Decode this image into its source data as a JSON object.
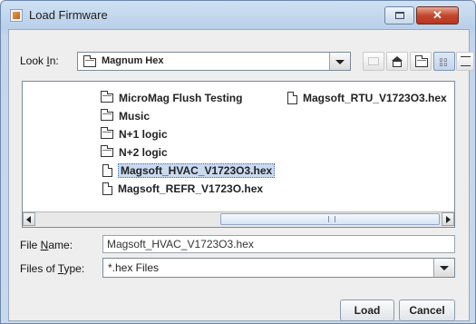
{
  "window": {
    "title": "Load Firmware",
    "close_glyph": "✕"
  },
  "look_in": {
    "label_pre": "Look ",
    "label_key": "I",
    "label_post": "n:",
    "value": "Magnum Hex"
  },
  "toolbar": {
    "icons": [
      "up-one-level-icon",
      "home-icon",
      "new-folder-icon",
      "list-view-icon",
      "details-view-icon"
    ]
  },
  "files": {
    "col1": [
      {
        "name": "MicroMag Flush Testing",
        "type": "folder"
      },
      {
        "name": "Music",
        "type": "folder"
      },
      {
        "name": "N+1 logic",
        "type": "folder"
      },
      {
        "name": "N+2 logic",
        "type": "folder"
      },
      {
        "name": "Magsoft_HVAC_V1723O3.hex",
        "type": "file",
        "selected": true
      },
      {
        "name": "Magsoft_REFR_V1723O.hex",
        "type": "file"
      }
    ],
    "col2": [
      {
        "name": "Magsoft_RTU_V1723O3.hex",
        "type": "file"
      }
    ]
  },
  "file_name": {
    "label_pre": "File ",
    "label_key": "N",
    "label_post": "ame:",
    "value": "Magsoft_HVAC_V1723O3.hex"
  },
  "file_type": {
    "label_pre": "Files of ",
    "label_key": "T",
    "label_post": "ype:",
    "value": "*.hex Files"
  },
  "buttons": {
    "load": "Load",
    "cancel": "Cancel"
  }
}
